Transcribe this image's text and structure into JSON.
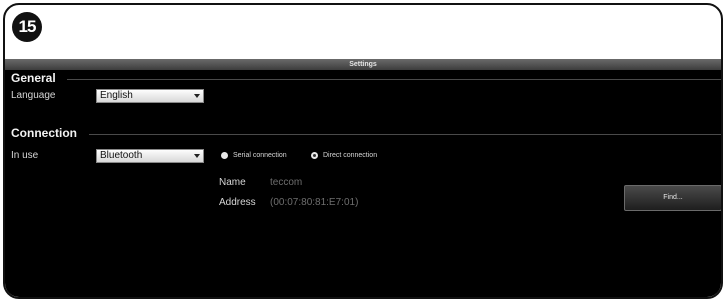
{
  "step_number": "15",
  "window": {
    "title": "Settings"
  },
  "general": {
    "section_title": "General",
    "language_label": "Language",
    "language_value": "English"
  },
  "connection": {
    "section_title": "Connection",
    "in_use_label": "In use",
    "in_use_value": "Bluetooth",
    "radio_serial_label": "Serial connection",
    "radio_direct_label": "Direct connection",
    "radio_selected": "Direct connection",
    "name_label": "Name",
    "name_value": "teccom",
    "address_label": "Address",
    "address_value": "(00:07:80:81:E7:01)",
    "find_button_label": "Find..."
  }
}
